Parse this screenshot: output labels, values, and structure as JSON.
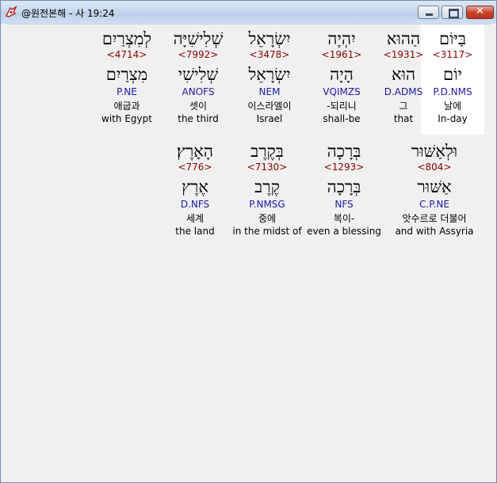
{
  "window": {
    "title": "@원전본해 - 사 19:24",
    "close_glyph": "✕"
  },
  "rows": [
    {
      "words": [
        {
          "hebrew": "בַּיּוֹם",
          "strong": "<3117>",
          "lemma": "יוֹם",
          "morph": "P.D.NMS",
          "korean": "날에",
          "english": "In-day",
          "highlighted": true
        },
        {
          "hebrew": "הַהוּא",
          "strong": "<1931>",
          "lemma": "הוּא",
          "morph": "D.ADMS",
          "korean": "그",
          "english": "that",
          "highlighted": false
        },
        {
          "hebrew": "יִהְיֶה",
          "strong": "<1961>",
          "lemma": "הָיָה",
          "morph": "VQIMZS",
          "korean": "-되리니",
          "english": "shall-be",
          "highlighted": false
        },
        {
          "hebrew": "יִשְׂרָאֵל",
          "strong": "<3478>",
          "lemma": "יִשְׂרָאֵל",
          "morph": "NEM",
          "korean": "이스라엘이",
          "english": "Israel",
          "highlighted": false
        },
        {
          "hebrew": "שְׁלִישִׁיָּה",
          "strong": "<7992>",
          "lemma": "שְׁלִישִׁי",
          "morph": "ANOFS",
          "korean": "셋이",
          "english": "the third",
          "highlighted": false
        },
        {
          "hebrew": "לְמִצְרַיִם",
          "strong": "<4714>",
          "lemma": "מִצְרַיִם",
          "morph": "P.NE",
          "korean": "애굽과",
          "english": "with Egypt",
          "highlighted": false
        }
      ]
    },
    {
      "words": [
        {
          "hebrew": "וּלְאַשּׁוּר",
          "strong": "<804>",
          "lemma": "אַשּׁוּר",
          "morph": "C.P.NE",
          "korean": "앗수르로 더불어",
          "english": "and with Assyria",
          "highlighted": false
        },
        {
          "hebrew": "בְּרָכָה",
          "strong": "<1293>",
          "lemma": "בְּרָכָה",
          "morph": "NFS",
          "korean": "복이-",
          "english": "even a blessing",
          "highlighted": false
        },
        {
          "hebrew": "בְּקֶרֶב",
          "strong": "<7130>",
          "lemma": "קֶרֶב",
          "morph": "P.NMSG",
          "korean": "중에",
          "english": "in the midst of",
          "highlighted": false
        },
        {
          "hebrew": "הָאָרֶץ׃",
          "strong": "<776>",
          "lemma": "אֶרֶץ",
          "morph": "D.NFS",
          "korean": "세계",
          "english": "the land",
          "highlighted": false
        }
      ]
    }
  ]
}
